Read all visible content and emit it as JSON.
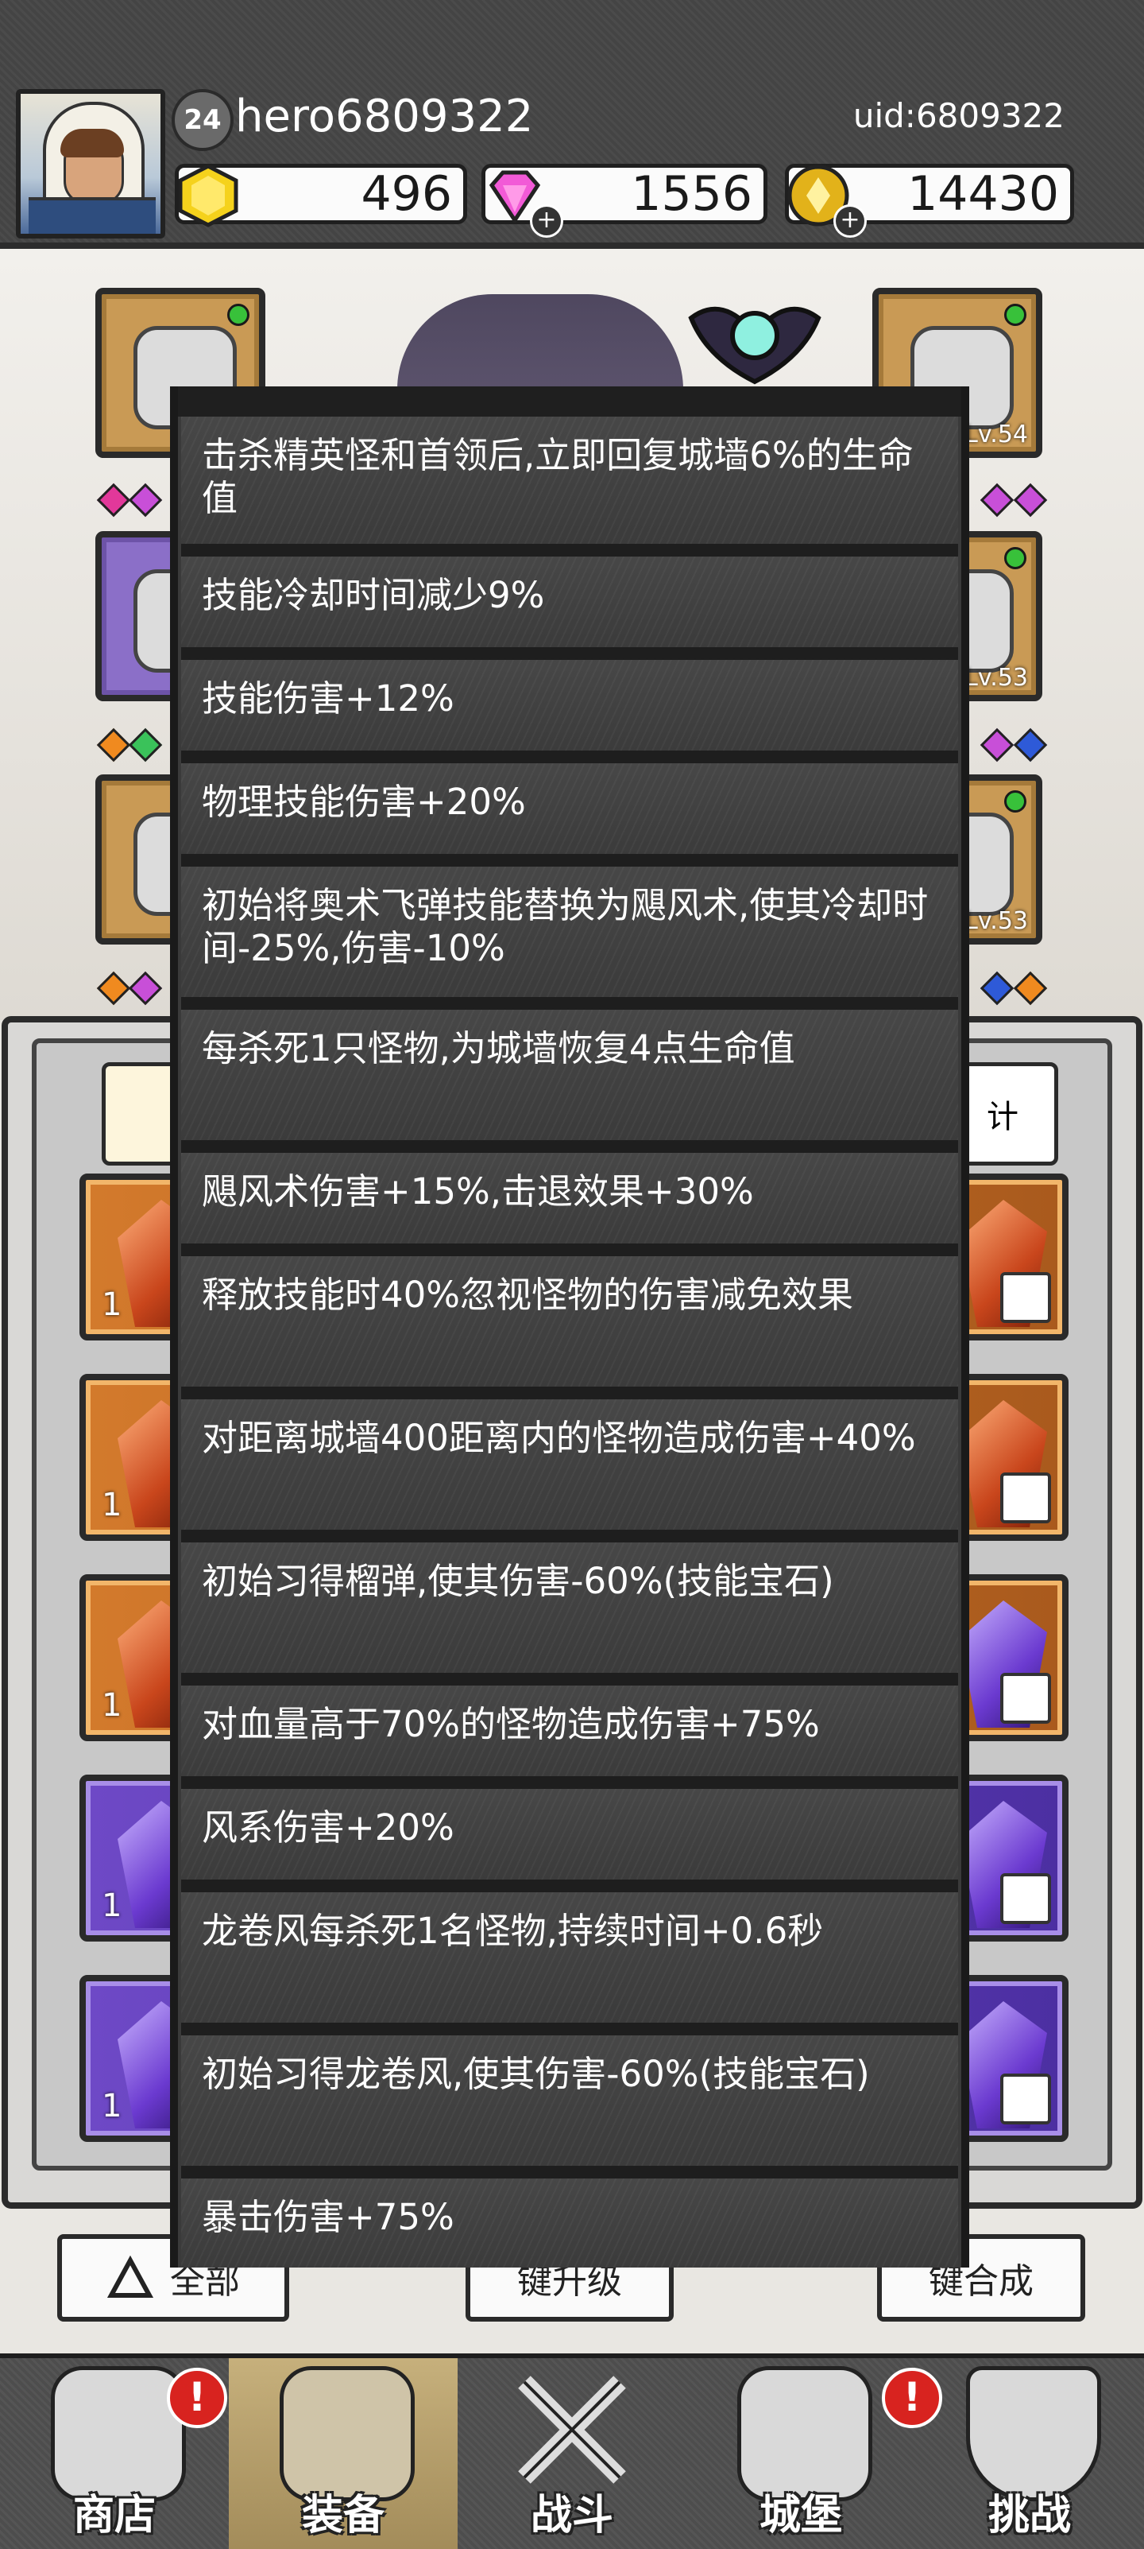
{
  "header": {
    "level": "24",
    "username": "hero6809322",
    "uid": "uid:6809322",
    "resources": [
      {
        "icon": "gold-gem-icon",
        "value": "496"
      },
      {
        "icon": "pink-diamond-icon",
        "value": "1556"
      },
      {
        "icon": "gold-coin-icon",
        "value": "14430"
      }
    ]
  },
  "equipment": {
    "slot_levels": [
      "Lv.54",
      "Lv.53",
      "Lv.53"
    ]
  },
  "panel": {
    "right_tab_label": "计",
    "item_count": "1"
  },
  "actions": {
    "all_label": "全部",
    "upgrade_label": "键升级",
    "merge_label": "键合成"
  },
  "tooltip": {
    "entries": [
      "击杀精英怪和首领后,立即回复城墙6%的生命值",
      "技能冷却时间减少9%",
      "技能伤害+12%",
      "物理技能伤害+20%",
      "初始将奥术飞弹技能替换为飓风术,使其冷却时间-25%,伤害-10%",
      "每杀死1只怪物,为城墙恢复4点生命值",
      "飓风术伤害+15%,击退效果+30%",
      "释放技能时40%忽视怪物的伤害减免效果",
      "对距离城墙400距离内的怪物造成伤害+40%",
      "初始习得榴弹,使其伤害-60%(技能宝石)",
      "对血量高于70%的怪物造成伤害+75%",
      "风系伤害+20%",
      "龙卷风每杀死1名怪物,持续时间+0.6秒",
      "初始习得龙卷风,使其伤害-60%(技能宝石)",
      "暴击伤害+75%"
    ]
  },
  "nav": {
    "items": [
      {
        "label": "商店",
        "alert": "!"
      },
      {
        "label": "装备",
        "alert": ""
      },
      {
        "label": "战斗",
        "alert": ""
      },
      {
        "label": "城堡",
        "alert": "!"
      },
      {
        "label": "挑战",
        "alert": ""
      }
    ]
  },
  "colors": {
    "orange_rarity": "#d37a2c",
    "purple_rarity": "#6e49c6",
    "tooltip_bg": "#3a3a3a",
    "alert_red": "#d8231f"
  }
}
